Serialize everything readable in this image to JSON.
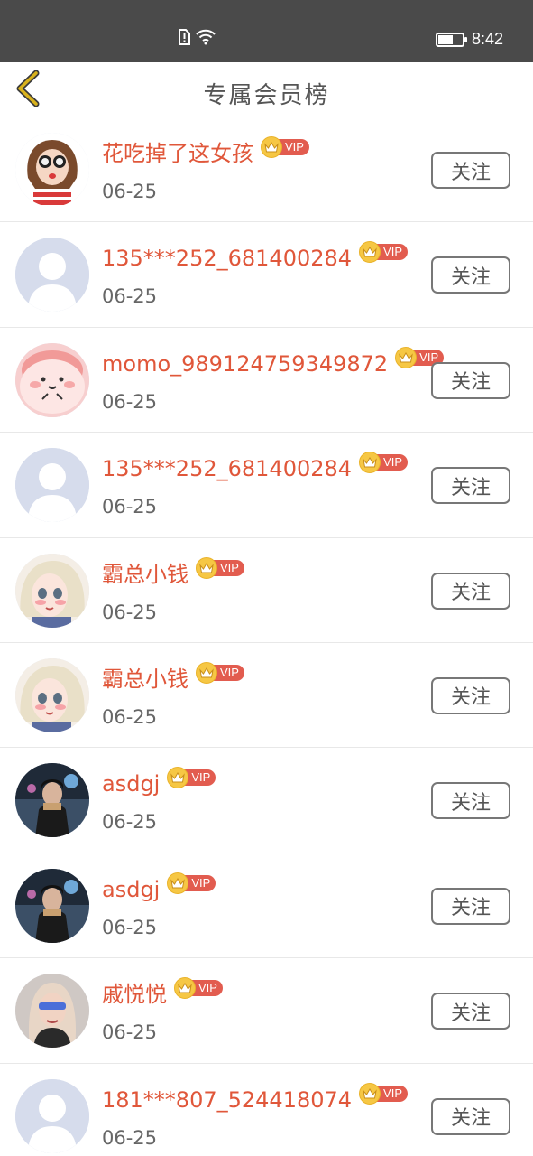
{
  "status_bar": {
    "time": "8:42",
    "icons": [
      "sim-alert-icon",
      "wifi-icon",
      "battery-icon"
    ],
    "battery_level": 0.6
  },
  "header": {
    "title": "专属会员榜",
    "back_icon": "chevron-left-icon",
    "accent_color": "#d9b21c"
  },
  "colors": {
    "name": "#e0573a",
    "vip_tag": "#e25c4f",
    "crown": "#f6c744"
  },
  "members": [
    {
      "name": "花吃掉了这女孩",
      "vip": "VIP",
      "date": "06-25",
      "button": "关注",
      "avatar": "girl-glasses-avatar"
    },
    {
      "name": "135***252_681400284",
      "vip": "VIP",
      "date": "06-25",
      "button": "关注",
      "avatar": "default-person-avatar"
    },
    {
      "name": "momo_989124759349872",
      "vip": "VIP",
      "date": "06-25",
      "button": "关注",
      "avatar": "pink-blob-avatar"
    },
    {
      "name": "135***252_681400284",
      "vip": "VIP",
      "date": "06-25",
      "button": "关注",
      "avatar": "default-person-avatar"
    },
    {
      "name": "霸总小钱",
      "vip": "VIP",
      "date": "06-25",
      "button": "关注",
      "avatar": "anime-girl-avatar"
    },
    {
      "name": "霸总小钱",
      "vip": "VIP",
      "date": "06-25",
      "button": "关注",
      "avatar": "anime-girl-avatar"
    },
    {
      "name": "asdgj",
      "vip": "VIP",
      "date": "06-25",
      "button": "关注",
      "avatar": "man-photo-avatar"
    },
    {
      "name": "asdgj",
      "vip": "VIP",
      "date": "06-25",
      "button": "关注",
      "avatar": "man-photo-avatar"
    },
    {
      "name": "戚悦悦",
      "vip": "VIP",
      "date": "06-25",
      "button": "关注",
      "avatar": "woman-photo-avatar"
    },
    {
      "name": "181***807_524418074",
      "vip": "VIP",
      "date": "06-25",
      "button": "关注",
      "avatar": "default-person-avatar"
    }
  ]
}
